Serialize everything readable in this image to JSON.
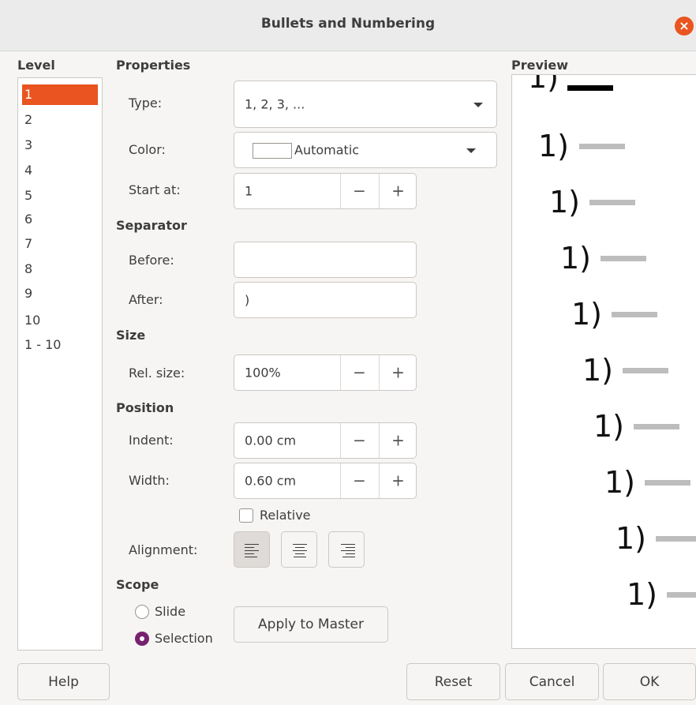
{
  "dialog": {
    "title": "Bullets and Numbering",
    "close_icon": "close-icon",
    "accent_color": "#e95420"
  },
  "level": {
    "header": "Level",
    "items": [
      "1",
      "2",
      "3",
      "4",
      "5",
      "6",
      "7",
      "8",
      "9",
      "10",
      "1 - 10"
    ],
    "selected": "1"
  },
  "properties": {
    "header": "Properties",
    "type_label": "Type:",
    "type_value": "1, 2, 3, ...",
    "color_label": "Color:",
    "color_value": "Automatic",
    "start_label": "Start at:",
    "start_value": "1"
  },
  "separator": {
    "header": "Separator",
    "before_label": "Before:",
    "before_value": "",
    "after_label": "After:",
    "after_value": ")"
  },
  "size": {
    "header": "Size",
    "rel_label": "Rel. size:",
    "rel_value": "100%"
  },
  "position": {
    "header": "Position",
    "indent_label": "Indent:",
    "indent_value": "0.00 cm",
    "width_label": "Width:",
    "width_value": "0.60 cm",
    "relative_label": "Relative",
    "relative_checked": false,
    "alignment_label": "Alignment:",
    "alignment_selected": "left"
  },
  "scope": {
    "header": "Scope",
    "slide_label": "Slide",
    "selection_label": "Selection",
    "selected": "Selection",
    "apply_master_label": "Apply to Master"
  },
  "preview": {
    "header": "Preview",
    "number_text": "1)"
  },
  "spin": {
    "minus": "−",
    "plus": "+"
  },
  "footer": {
    "help": "Help",
    "reset": "Reset",
    "cancel": "Cancel",
    "ok": "OK"
  }
}
